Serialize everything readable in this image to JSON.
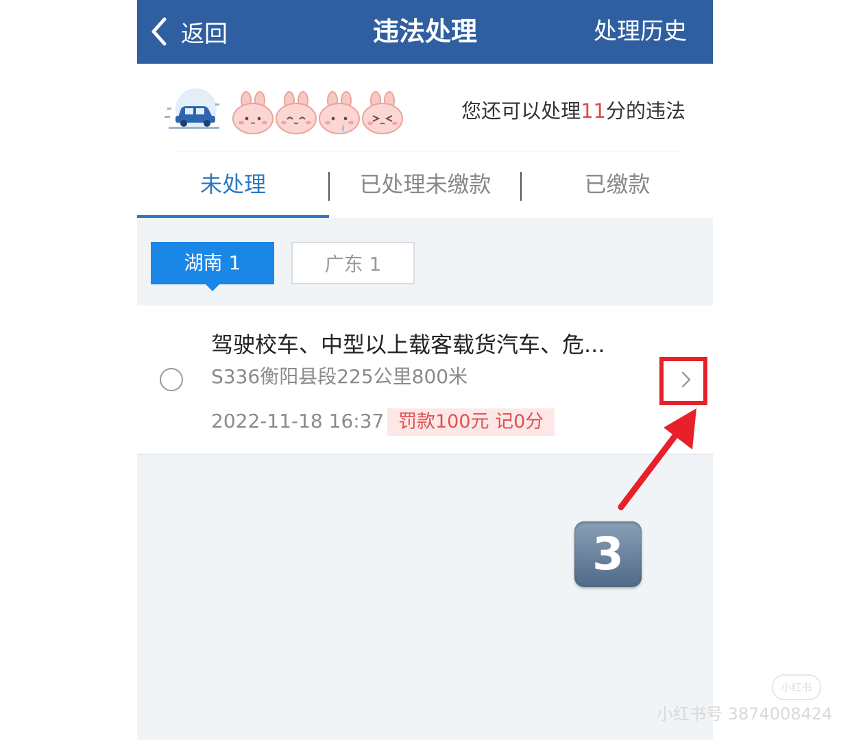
{
  "header": {
    "back_label": "返回",
    "title": "违法处理",
    "history_label": "处理历史"
  },
  "banner": {
    "prefix": "您还可以处理",
    "points": "11",
    "suffix": "分的违法"
  },
  "tabs": [
    {
      "label": "未处理",
      "active": true
    },
    {
      "label": "已处理未缴款",
      "active": false
    },
    {
      "label": "已缴款",
      "active": false
    }
  ],
  "filters": [
    {
      "label": "湖南 1",
      "active": true
    },
    {
      "label": "广东 1",
      "active": false
    }
  ],
  "violation": {
    "title": "驾驶校车、中型以上载客载货汽车、危...",
    "location": "S336衡阳县段225公里800米",
    "time": "2022-11-18 16:37",
    "penalty": "罚款100元  记0分"
  },
  "annotation": {
    "step": "3"
  },
  "watermark": {
    "logo": "小红书",
    "text": "小红书号 3874008424"
  },
  "colors": {
    "header": "#2f5fa0",
    "accent": "#2c78c4",
    "chip_active": "#1a86e6",
    "penalty_text": "#e05050",
    "highlight": "#e8202a"
  }
}
